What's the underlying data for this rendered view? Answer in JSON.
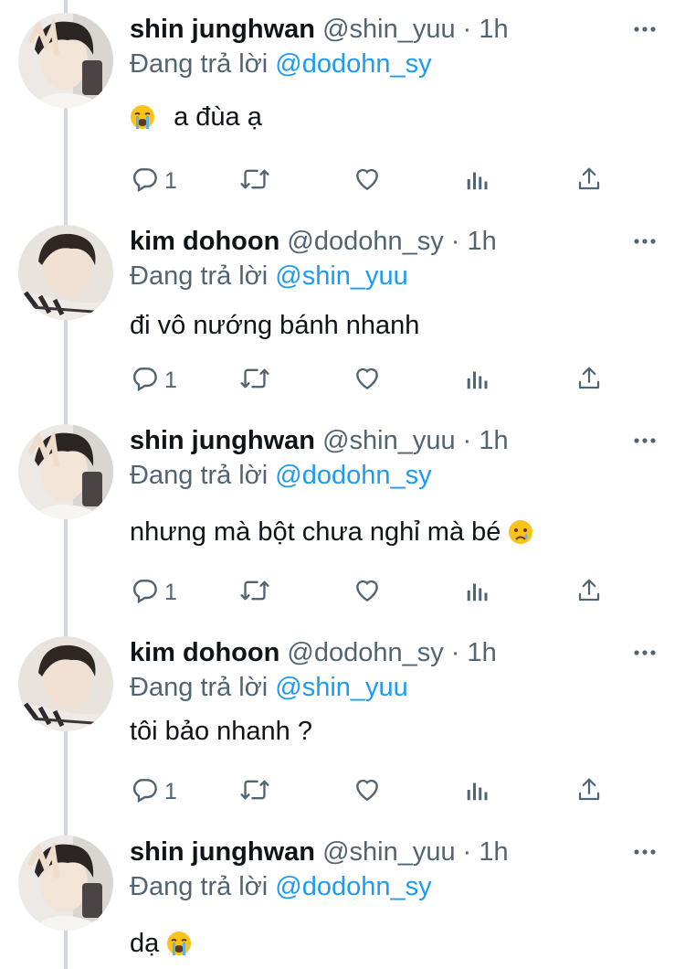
{
  "reply_prefix": "Đang trả lời",
  "users": {
    "shin": {
      "name": "shin junghwan",
      "handle": "@shin_yuu"
    },
    "kim": {
      "name": "kim dohoon",
      "handle": "@dodohn_sy"
    }
  },
  "tweets": [
    {
      "author": "shin junghwan",
      "handle": "@shin_yuu",
      "separator": "·",
      "time": "1h",
      "reply_to": "@dodohn_sy",
      "emoji_before": "crying-face-emoji",
      "text": "a đùa ạ",
      "reply_count": "1"
    },
    {
      "author": "kim dohoon",
      "handle": "@dodohn_sy",
      "separator": "·",
      "time": "1h",
      "reply_to": "@shin_yuu",
      "text": "đi vô nướng bánh nhanh",
      "reply_count": "1"
    },
    {
      "author": "shin junghwan",
      "handle": "@shin_yuu",
      "separator": "·",
      "time": "1h",
      "reply_to": "@dodohn_sy",
      "text": "nhưng mà bột chưa nghỉ mà bé",
      "emoji_after": "sad-tear-face-emoji",
      "reply_count": "1"
    },
    {
      "author": "kim dohoon",
      "handle": "@dodohn_sy",
      "separator": "·",
      "time": "1h",
      "reply_to": "@shin_yuu",
      "text": "tôi bảo nhanh ?",
      "reply_count": "1"
    },
    {
      "author": "shin junghwan",
      "handle": "@shin_yuu",
      "separator": "·",
      "time": "1h",
      "reply_to": "@dodohn_sy",
      "text": "dạ",
      "emoji_after": "crying-face-emoji"
    }
  ],
  "icons": [
    "reply-icon",
    "retweet-icon",
    "like-icon",
    "views-icon",
    "share-icon",
    "more-options-icon"
  ],
  "colors": {
    "text": "#0f1419",
    "muted": "#536471",
    "link": "#1d9bf0",
    "thread_line": "#cfd9de"
  }
}
